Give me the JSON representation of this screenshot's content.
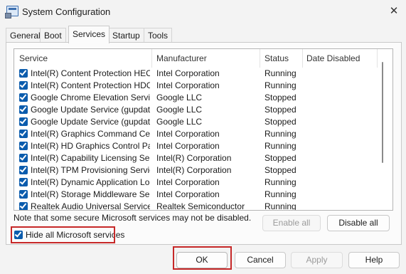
{
  "window": {
    "title": "System Configuration"
  },
  "tabs": [
    {
      "label": "General"
    },
    {
      "label": "Boot"
    },
    {
      "label": "Services"
    },
    {
      "label": "Startup"
    },
    {
      "label": "Tools"
    }
  ],
  "table": {
    "columns": [
      "Service",
      "Manufacturer",
      "Status",
      "Date Disabled"
    ],
    "rows": [
      {
        "service": "Intel(R) Content Protection HEC...",
        "manufacturer": "Intel Corporation",
        "status": "Running",
        "date_disabled": "",
        "checked": true
      },
      {
        "service": "Intel(R) Content Protection HDC...",
        "manufacturer": "Intel Corporation",
        "status": "Running",
        "date_disabled": "",
        "checked": true
      },
      {
        "service": "Google Chrome Elevation Servic...",
        "manufacturer": "Google LLC",
        "status": "Stopped",
        "date_disabled": "",
        "checked": true
      },
      {
        "service": "Google Update Service (gupdate)",
        "manufacturer": "Google LLC",
        "status": "Stopped",
        "date_disabled": "",
        "checked": true
      },
      {
        "service": "Google Update Service (gupdatem)",
        "manufacturer": "Google LLC",
        "status": "Stopped",
        "date_disabled": "",
        "checked": true
      },
      {
        "service": "Intel(R) Graphics Command Cen...",
        "manufacturer": "Intel Corporation",
        "status": "Running",
        "date_disabled": "",
        "checked": true
      },
      {
        "service": "Intel(R) HD Graphics Control Pa...",
        "manufacturer": "Intel Corporation",
        "status": "Running",
        "date_disabled": "",
        "checked": true
      },
      {
        "service": "Intel(R) Capability Licensing Ser...",
        "manufacturer": "Intel(R) Corporation",
        "status": "Stopped",
        "date_disabled": "",
        "checked": true
      },
      {
        "service": "Intel(R) TPM Provisioning Service",
        "manufacturer": "Intel(R) Corporation",
        "status": "Stopped",
        "date_disabled": "",
        "checked": true
      },
      {
        "service": "Intel(R) Dynamic Application Loa...",
        "manufacturer": "Intel Corporation",
        "status": "Running",
        "date_disabled": "",
        "checked": true
      },
      {
        "service": "Intel(R) Storage Middleware Ser...",
        "manufacturer": "Intel Corporation",
        "status": "Running",
        "date_disabled": "",
        "checked": true
      },
      {
        "service": "Realtek Audio Universal Service",
        "manufacturer": "Realtek Semiconductor",
        "status": "Running",
        "date_disabled": "",
        "checked": true
      }
    ]
  },
  "note": "Note that some secure Microsoft services may not be disabled.",
  "enable_all_label": "Enable all",
  "disable_all_label": "Disable all",
  "hide_ms_label": "Hide all Microsoft services",
  "hide_ms_checked": true,
  "buttons": {
    "ok": "OK",
    "cancel": "Cancel",
    "apply": "Apply",
    "help": "Help"
  },
  "icons": {
    "close": "✕"
  },
  "colors": {
    "checkbox": "#0b5cad",
    "highlight": "#c62828"
  }
}
